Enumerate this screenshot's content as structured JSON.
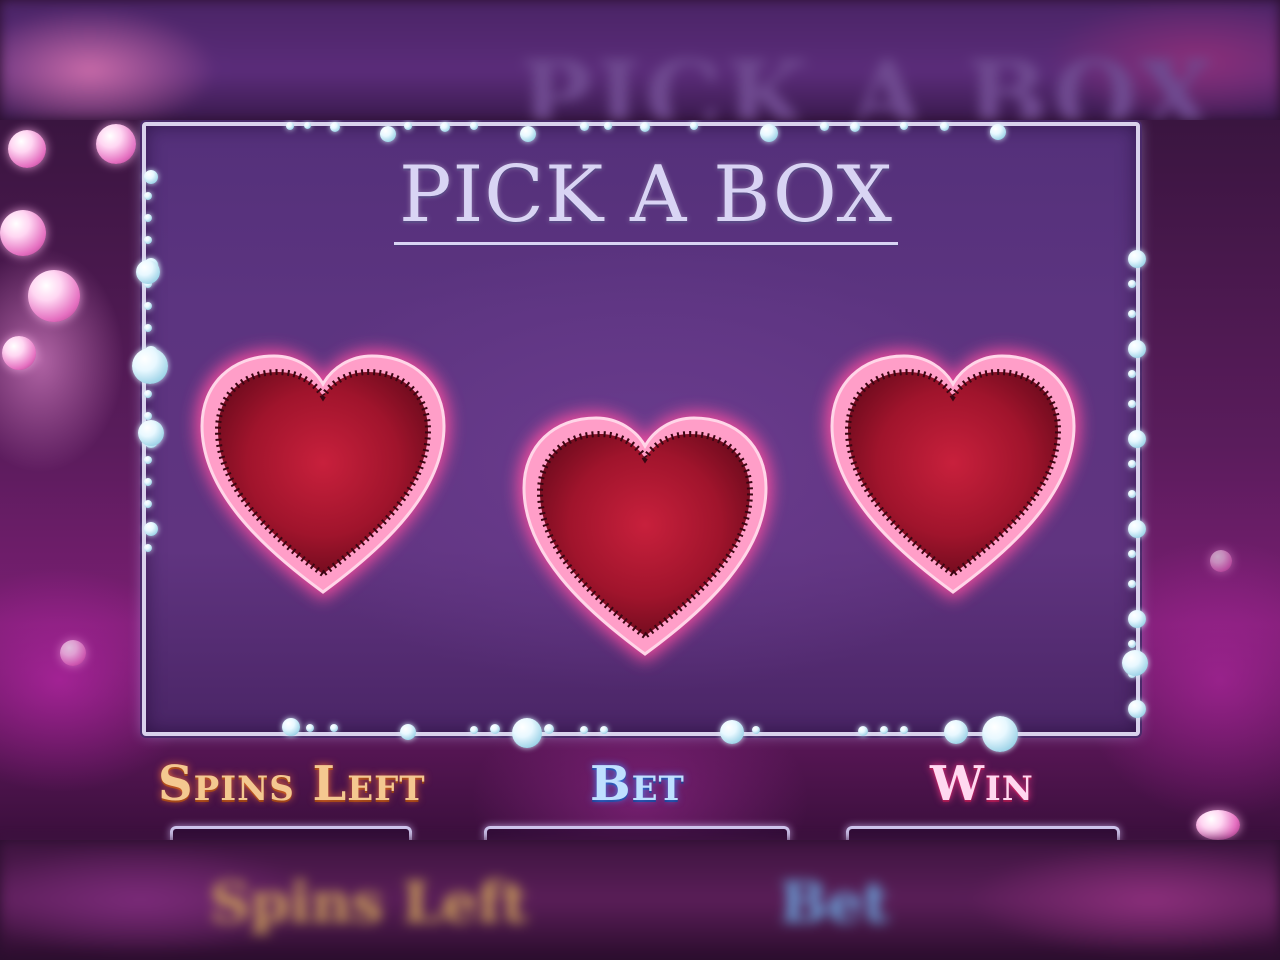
{
  "game": {
    "title": "PICK A BOX",
    "boxes": [
      {
        "label": "heart-box-1",
        "shape": "heart"
      },
      {
        "label": "heart-box-2",
        "shape": "heart"
      },
      {
        "label": "heart-box-3",
        "shape": "heart"
      }
    ],
    "status": {
      "spins_left_label": "Spins Left",
      "bet_label": "Bet",
      "win_label": "Win"
    }
  },
  "colors": {
    "panel": "#5c3480",
    "title": "#d9d4f4",
    "heart_glow": "#ff6fb0",
    "heart_fill": "#c0203a",
    "spins_label": "#f4c890",
    "bet_label": "#bfe0ff",
    "win_label": "#ffd8f0"
  }
}
